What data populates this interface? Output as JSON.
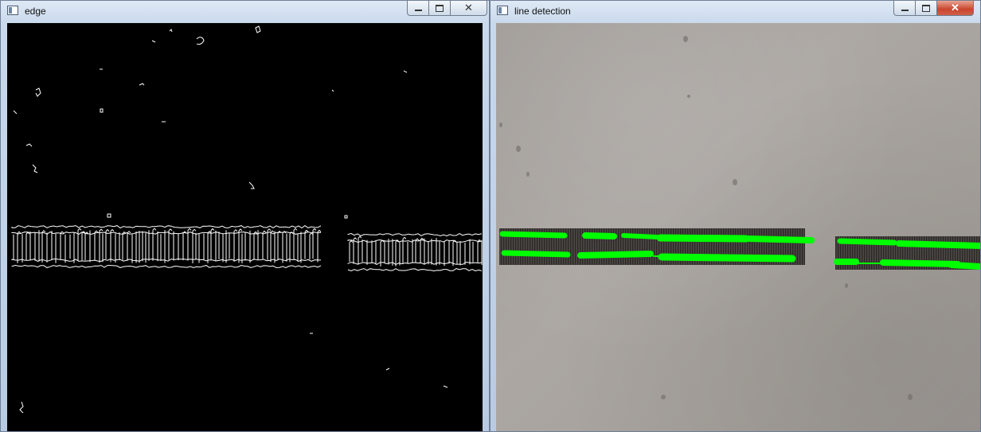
{
  "windows": {
    "edge": {
      "title": "edge",
      "controls": [
        "minimize",
        "maximize",
        "close"
      ]
    },
    "line_detection": {
      "title": "line detection",
      "controls": [
        "minimize",
        "maximize",
        "close"
      ]
    }
  },
  "colors": {
    "edge_background": "#000000",
    "edge_lines": "#ffffff",
    "detected_line": "#00ff00",
    "close_button_active": "#c9452d"
  },
  "icons": {
    "window_icon": "app-window-icon",
    "minimize": "minimize-icon",
    "maximize": "maximize-icon",
    "close": "close-icon"
  }
}
